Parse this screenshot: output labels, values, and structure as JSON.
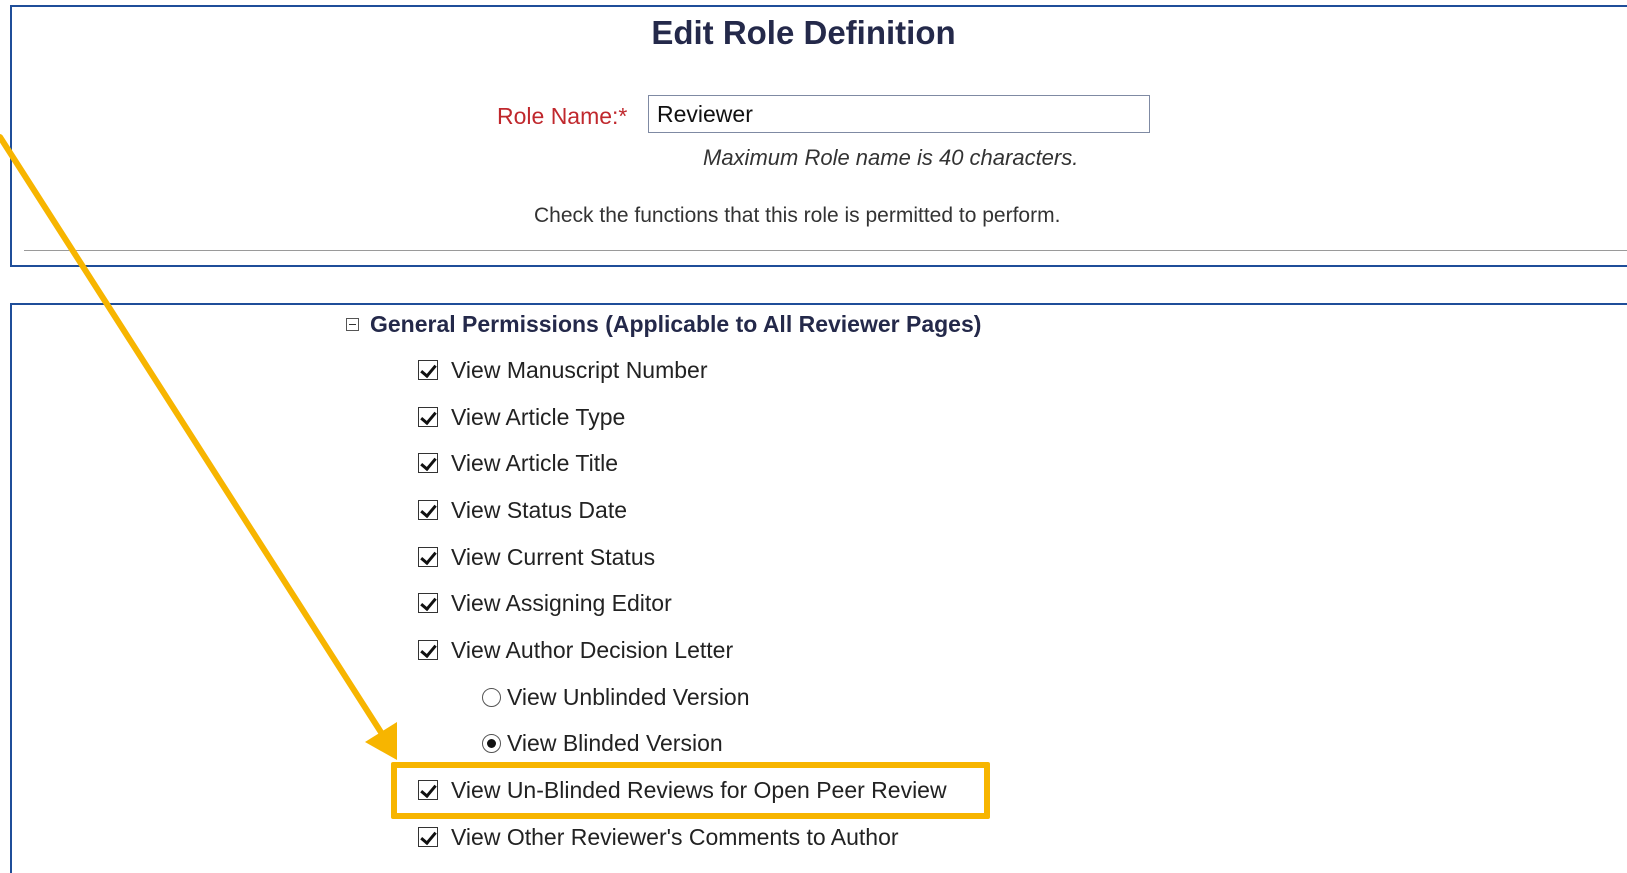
{
  "header": {
    "title": "Edit Role Definition"
  },
  "role": {
    "label": "Role Name:*",
    "value": "Reviewer",
    "hint": "Maximum Role name is 40 characters.",
    "instructions": "Check the functions that this role is permitted to perform."
  },
  "permissions": {
    "section_title": "General Permissions (Applicable to All Reviewer Pages)",
    "items": [
      {
        "label": "View Manuscript Number",
        "checked": true
      },
      {
        "label": "View Article Type",
        "checked": true
      },
      {
        "label": "View Article Title",
        "checked": true
      },
      {
        "label": "View Status Date",
        "checked": true
      },
      {
        "label": "View Current Status",
        "checked": true
      },
      {
        "label": "View Assigning Editor",
        "checked": true
      },
      {
        "label": "View Author Decision Letter",
        "checked": true
      }
    ],
    "version_options": [
      {
        "label": "View Unblinded Version",
        "selected": false
      },
      {
        "label": "View Blinded Version",
        "selected": true
      }
    ],
    "extra_items": [
      {
        "label": "View Un-Blinded Reviews for Open Peer Review",
        "checked": true,
        "highlighted": true
      },
      {
        "label": "View Other Reviewer's Comments to Author",
        "checked": true
      }
    ]
  },
  "annotation": {
    "color": "#f7b500"
  }
}
